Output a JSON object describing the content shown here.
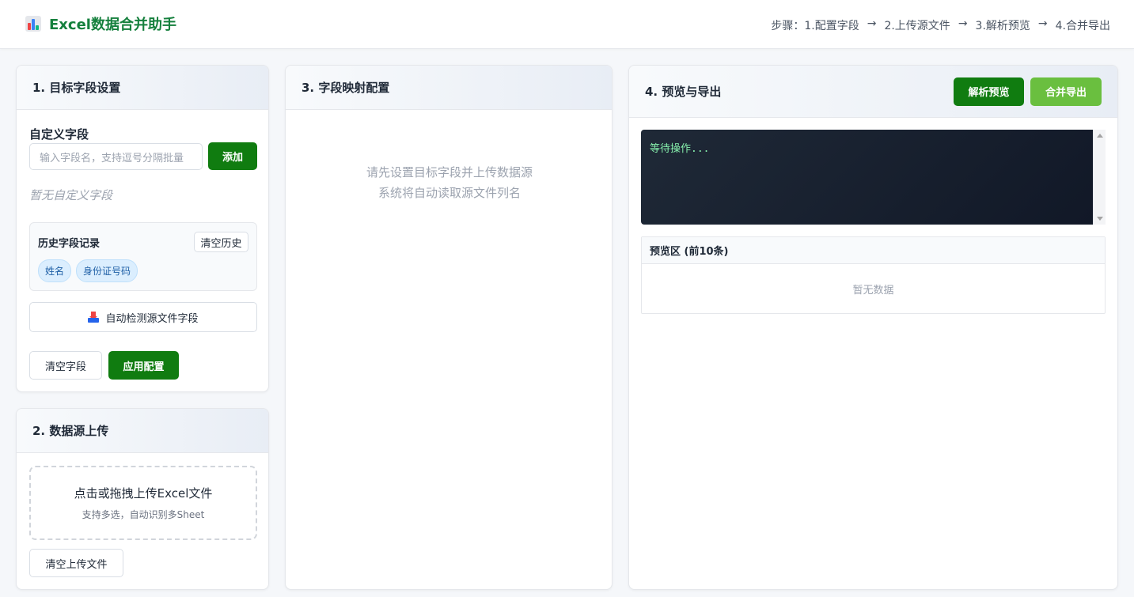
{
  "header": {
    "app_title": "Excel数据合并助手",
    "steps_label": "步骤：",
    "steps": [
      "1.配置字段",
      "2.上传源文件",
      "3.解析预览",
      "4.合并导出"
    ],
    "arrow": "→"
  },
  "field_settings": {
    "title": "1. 目标字段设置",
    "custom_label": "自定义字段",
    "input_placeholder": "输入字段名，支持逗号分隔批量",
    "add_button": "添加",
    "empty_text": "暂无自定义字段",
    "history_title": "历史字段记录",
    "clear_history_button": "清空历史",
    "history_tags": [
      "姓名",
      "身份证号码"
    ],
    "auto_detect_button": "自动检测源文件字段",
    "clear_fields_button": "清空字段",
    "apply_button": "应用配置"
  },
  "upload": {
    "title": "2. 数据源上传",
    "drop_main": "点击或拖拽上传Excel文件",
    "drop_sub": "支持多选，自动识别多Sheet",
    "clear_button": "清空上传文件"
  },
  "mapping": {
    "title": "3. 字段映射配置",
    "empty_line1": "请先设置目标字段并上传数据源",
    "empty_line2": "系统将自动读取源文件列名"
  },
  "preview_export": {
    "title": "4. 预览与导出",
    "parse_button": "解析预览",
    "export_button": "合并导出",
    "console_text": "等待操作...",
    "preview_title": "预览区 (前10条)",
    "preview_empty": "暂无数据"
  },
  "colors": {
    "brand_green": "#107c10",
    "light_green": "#6abf3f",
    "console_bg": "#111827",
    "console_text": "#86efac"
  }
}
